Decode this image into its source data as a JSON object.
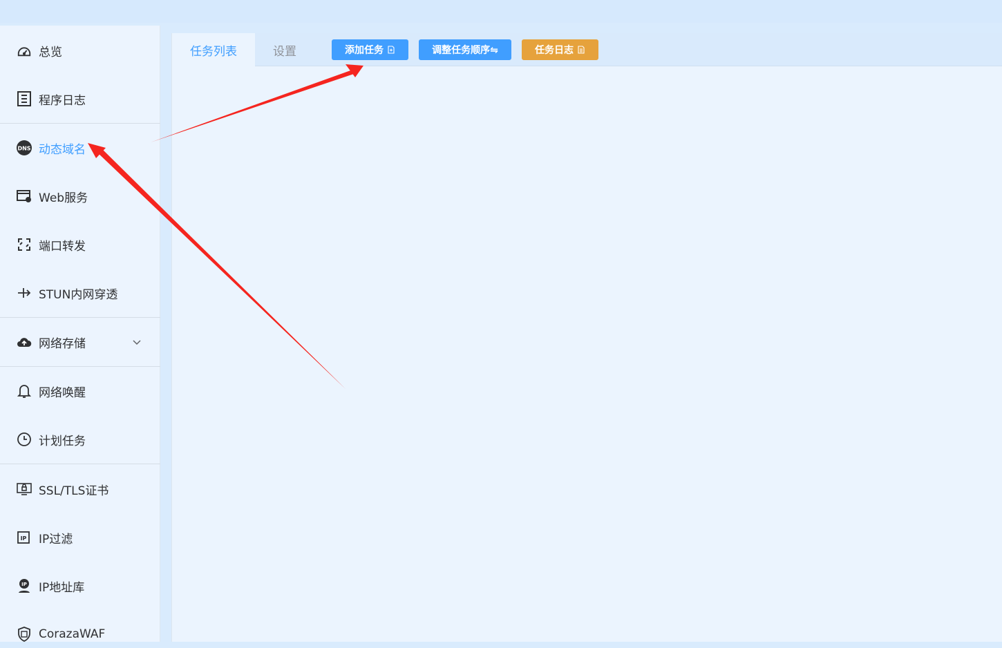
{
  "sidebar": {
    "items": [
      {
        "label": "总览",
        "icon": "dashboard-icon"
      },
      {
        "label": "程序日志",
        "icon": "log-icon"
      },
      {
        "label": "动态域名",
        "icon": "dns-icon",
        "active": true
      },
      {
        "label": "Web服务",
        "icon": "web-service-icon"
      },
      {
        "label": "端口转发",
        "icon": "port-forward-icon"
      },
      {
        "label": "STUN内网穿透",
        "icon": "stun-icon"
      },
      {
        "label": "网络存储",
        "icon": "cloud-upload-icon",
        "expandable": true
      },
      {
        "label": "网络唤醒",
        "icon": "bell-icon"
      },
      {
        "label": "计划任务",
        "icon": "clock-icon"
      },
      {
        "label": "SSL/TLS证书",
        "icon": "certificate-icon"
      },
      {
        "label": "IP过滤",
        "icon": "ip-filter-icon"
      },
      {
        "label": "IP地址库",
        "icon": "ip-database-icon"
      },
      {
        "label": "CorazaWAF",
        "icon": "shield-icon"
      }
    ]
  },
  "tabs": {
    "task_list": "任务列表",
    "settings": "设置"
  },
  "toolbar": {
    "add_task": "添加任务",
    "reorder_tasks": "调整任务顺序⇋",
    "task_log": "任务日志"
  },
  "colors": {
    "primary": "#409eff",
    "warning": "#e6a23c",
    "annotation_arrow": "#f5251f"
  }
}
